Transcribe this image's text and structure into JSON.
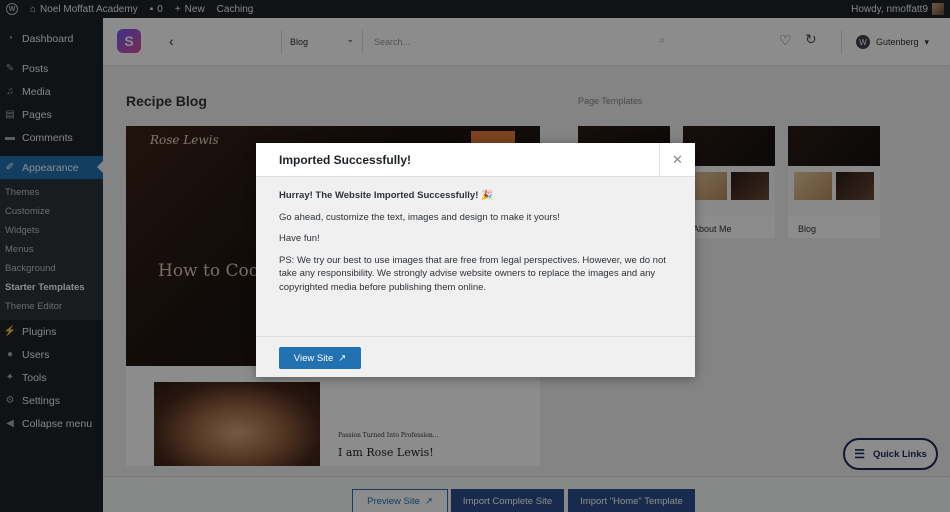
{
  "admin_bar": {
    "site_name": "Noel Moffatt Academy",
    "comments_count": "0",
    "new_label": "New",
    "caching_label": "Caching",
    "howdy": "Howdy, nmoffatt9"
  },
  "sidebar": {
    "items": [
      {
        "label": "Dashboard",
        "icon": "dashboard-icon"
      },
      {
        "label": "Posts",
        "icon": "pin-icon"
      },
      {
        "label": "Media",
        "icon": "media-icon"
      },
      {
        "label": "Pages",
        "icon": "pages-icon"
      },
      {
        "label": "Comments",
        "icon": "comment-icon"
      },
      {
        "label": "Appearance",
        "icon": "brush-icon"
      }
    ],
    "submenu": [
      "Themes",
      "Customize",
      "Widgets",
      "Menus",
      "Background",
      "Starter Templates",
      "Theme Editor"
    ],
    "items_after": [
      {
        "label": "Plugins"
      },
      {
        "label": "Users"
      },
      {
        "label": "Tools"
      },
      {
        "label": "Settings"
      },
      {
        "label": "Collapse menu"
      }
    ]
  },
  "topbar": {
    "category": "Blog",
    "search_placeholder": "Search...",
    "builder": "Gutenberg"
  },
  "main": {
    "title": "Recipe Blog",
    "section_label": "Page Templates",
    "hero_logo": "Rose Lewis",
    "hero_title": "How to Coo",
    "bio_kicker": "Passion Turned Into Profession...",
    "bio_name": "I am Rose Lewis!",
    "thumbs": [
      {
        "label": ""
      },
      {
        "label": "About Me"
      },
      {
        "label": "Blog"
      }
    ],
    "quick_links": "Quick Links"
  },
  "bottom": {
    "preview_site": "Preview Site",
    "import_complete": "Import Complete Site",
    "import_home": "Import \"Home\" Template"
  },
  "modal": {
    "title": "Imported Successfully!",
    "lead": "Hurray! The Website Imported Successfully! 🎉",
    "p1": "Go ahead, customize the text, images and design to make it yours!",
    "p2": "Have fun!",
    "p3": "PS: We try our best to use images that are free from legal perspectives. However, we do not take any responsibility. We strongly advise website owners to replace the images and any copyrighted media before publishing them online.",
    "view_site": "View Site"
  },
  "colors": {
    "admin_dark": "#1d2327",
    "wp_blue": "#2271b1",
    "button_navy": "#2d4f8e"
  }
}
